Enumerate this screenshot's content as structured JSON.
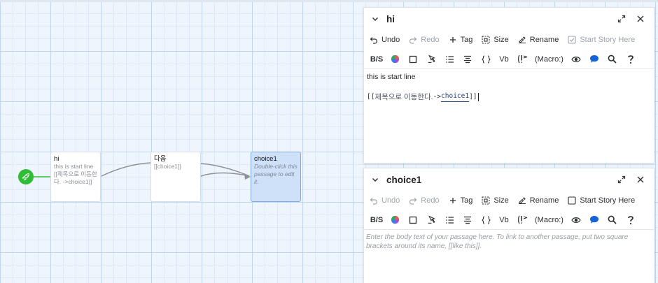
{
  "map": {
    "passages": [
      {
        "name": "hi",
        "excerpt": "this is start line [[제목으로 이동한다. ->choice1]]"
      },
      {
        "name": "다음",
        "excerpt": "[[choice1]]"
      },
      {
        "name": "choice1",
        "excerpt": "Double-click this passage to edit it."
      }
    ]
  },
  "dialogs": [
    {
      "title": "hi",
      "actions": {
        "undo": "Undo",
        "redo": "Redo",
        "tag": "Tag",
        "size": "Size",
        "rename": "Rename",
        "start": "Start Story Here"
      },
      "format": {
        "bs": "B/S",
        "vb": "Vb",
        "macro": "(Macro:)"
      },
      "body": {
        "line1": "this is start line",
        "link_open": "[[",
        "link_text": "제목으로 이동한다. ",
        "link_arrow": "->",
        "link_target": "choice1",
        "link_close": "]]"
      }
    },
    {
      "title": "choice1",
      "actions": {
        "undo": "Undo",
        "redo": "Redo",
        "tag": "Tag",
        "size": "Size",
        "rename": "Rename",
        "start": "Start Story Here"
      },
      "format": {
        "bs": "B/S",
        "vb": "Vb",
        "macro": "(Macro:)"
      },
      "placeholder": "Enter the body text of your passage here. To link to another passage, put two square brackets around its name, [[like this]]."
    }
  ]
}
